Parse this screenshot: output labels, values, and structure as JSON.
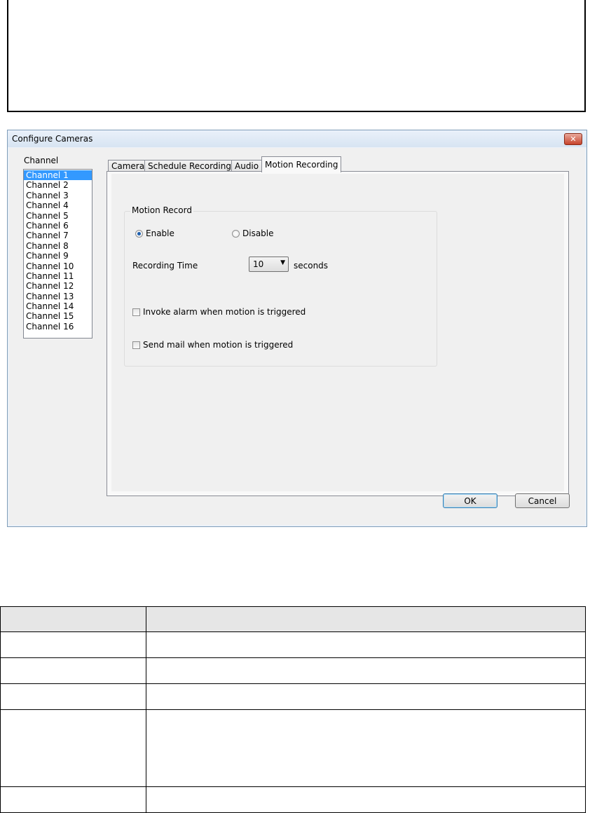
{
  "dialog": {
    "title": "Configure Cameras",
    "close_label": "✕",
    "channel_label": "Channel",
    "channels": [
      "Channel 1",
      "Channel 2",
      "Channel 3",
      "Channel 4",
      "Channel 5",
      "Channel 6",
      "Channel 7",
      "Channel 8",
      "Channel 9",
      "Channel 10",
      "Channel 11",
      "Channel 12",
      "Channel 13",
      "Channel 14",
      "Channel 15",
      "Channel 16"
    ],
    "selected_channel": "Channel 1",
    "tabs": [
      "Camera",
      "Schedule Recording",
      "Audio",
      "Motion Recording"
    ],
    "active_tab": "Motion Recording",
    "motion": {
      "group_title": "Motion Record",
      "enable_label": "Enable",
      "disable_label": "Disable",
      "enabled": true,
      "recording_time_label": "Recording Time",
      "recording_time_value": "10",
      "seconds_label": "seconds",
      "invoke_alarm_label": "Invoke alarm when motion is triggered",
      "invoke_alarm_checked": false,
      "send_mail_label": "Send mail when motion is triggered",
      "send_mail_checked": false
    },
    "ok_label": "OK",
    "cancel_label": "Cancel"
  },
  "colors": {
    "selection": "#3399ff",
    "close_button": "#c7432b"
  },
  "icons": {
    "close": "close-icon",
    "dropdown": "chevron-down-icon"
  }
}
